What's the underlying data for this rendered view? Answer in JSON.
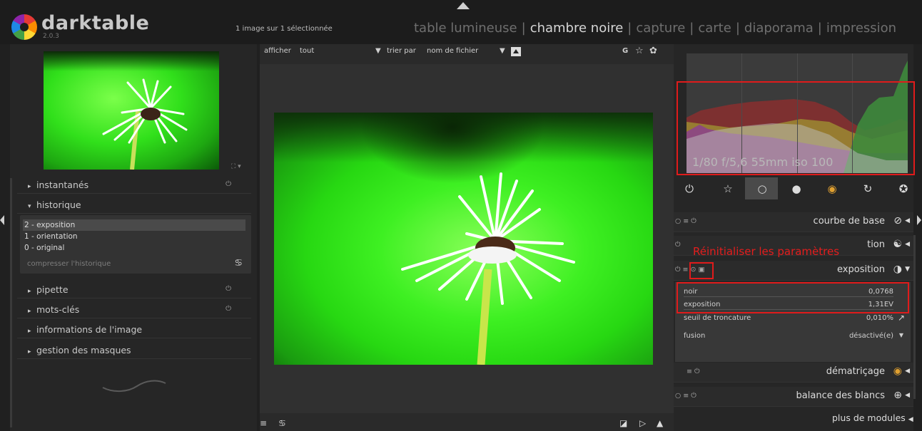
{
  "header": {
    "app_name": "darktable",
    "app_version": "2.0.3",
    "selection_info": "1 image sur 1 sélectionnée",
    "views": [
      {
        "label": "table lumineuse",
        "active": false
      },
      {
        "label": "chambre noire",
        "active": true
      },
      {
        "label": "capture",
        "active": false
      },
      {
        "label": "carte",
        "active": false
      },
      {
        "label": "diaporama",
        "active": false
      },
      {
        "label": "impression",
        "active": false
      }
    ],
    "separator": "|"
  },
  "left_panel": {
    "sections": {
      "snapshots": "instantanés",
      "history": "historique",
      "color_picker": "pipette",
      "tagging": "mots-clés",
      "image_info": "informations de l'image",
      "mask_manager": "gestion des masques"
    },
    "history_items": [
      "2 - exposition",
      "1 - orientation",
      "0 - original"
    ],
    "compress_history": "compresser l'historique"
  },
  "center": {
    "filter_label": "afficher",
    "filter_value": "tout",
    "sort_label": "trier par",
    "sort_value": "nom de fichier",
    "grouping_label": "G"
  },
  "right_panel": {
    "histogram_info": "1/80 f/5,6 55mm iso 100",
    "modules": {
      "base_curve": "courbe de base",
      "cropped_name": "tion",
      "exposure": "exposition",
      "demosaic": "dématriçage",
      "white_balance": "balance des blancs"
    },
    "tooltip": "Réinitialiser les paramètres",
    "exposure_params": [
      {
        "label": "noir",
        "value": "0,0768"
      },
      {
        "label": "exposition",
        "value": "1,31EV"
      },
      {
        "label": "seuil de troncature",
        "value": "0,010%"
      }
    ],
    "blend_label": "fusion",
    "blend_value": "désactivé(e)",
    "more_modules": "plus de modules"
  },
  "colors": {
    "highlight": "#e01b1b",
    "background": "#202020",
    "panel": "#262626"
  }
}
